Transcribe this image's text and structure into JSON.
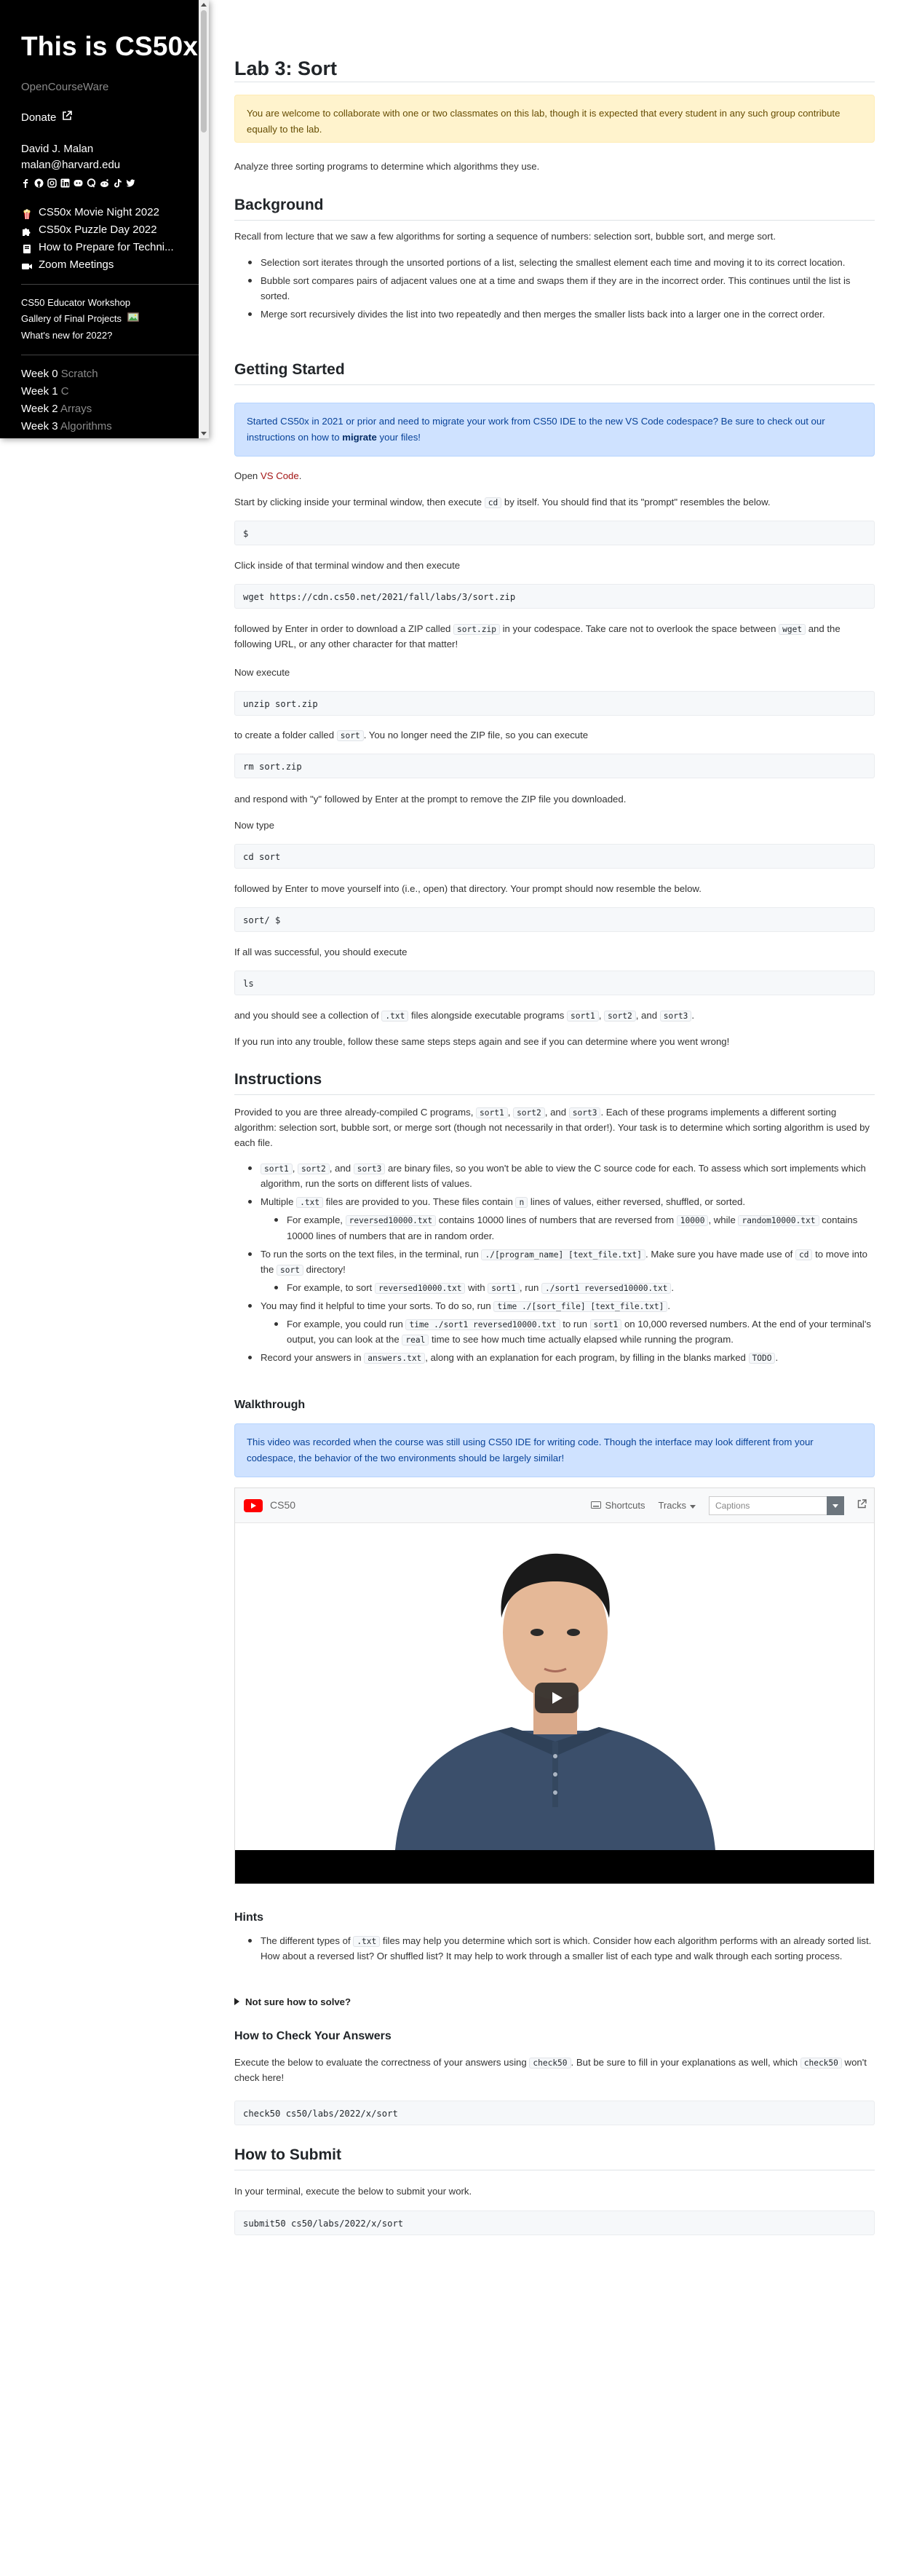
{
  "sidebar": {
    "title": "This is CS50x",
    "subtitle": "OpenCourseWare",
    "donate": "Donate",
    "author_name": "David J. Malan",
    "author_email": "malan@harvard.edu",
    "events": [
      {
        "icon": "popcorn-icon",
        "label": "CS50x Movie Night 2022"
      },
      {
        "icon": "puzzle-icon",
        "label": "CS50x Puzzle Day 2022"
      },
      {
        "icon": "book-icon",
        "label": "How to Prepare for Techni..."
      },
      {
        "icon": "video-camera-icon",
        "label": "Zoom Meetings"
      }
    ],
    "extras": [
      "CS50 Educator Workshop",
      "Gallery of Final Projects",
      "What's new for 2022?"
    ],
    "weeks": [
      {
        "num": "Week 0",
        "topic": "Scratch"
      },
      {
        "num": "Week 1",
        "topic": "C"
      },
      {
        "num": "Week 2",
        "topic": "Arrays"
      },
      {
        "num": "Week 3",
        "topic": "Algorithms"
      }
    ]
  },
  "page": {
    "title": "Lab 3: Sort",
    "collab_notice": "You are welcome to collaborate with one or two classmates on this lab, though it is expected that every student in any such group contribute equally to the lab.",
    "intro": "Analyze three sorting programs to determine which algorithms they use.",
    "background": {
      "heading": "Background",
      "text": "Recall from lecture that we saw a few algorithms for sorting a sequence of numbers: selection sort, bubble sort, and merge sort.",
      "bullets": [
        "Selection sort iterates through the unsorted portions of a list, selecting the smallest element each time and moving it to its correct location.",
        "Bubble sort compares pairs of adjacent values one at a time and swaps them if they are in the incorrect order. This continues until the list is sorted.",
        "Merge sort recursively divides the list into two repeatedly and then merges the smaller lists back into a larger one in the correct order."
      ]
    },
    "getting_started": {
      "heading": "Getting Started",
      "migrate_notice_pre": "Started CS50x in 2021 or prior and need to migrate your work from CS50 IDE to the new VS Code codespace? Be sure to check out our instructions on how to ",
      "migrate_notice_link": "migrate",
      "migrate_notice_post": " your files!",
      "open_pre": "Open ",
      "open_link": "VS Code",
      "open_post": ".",
      "start_text_pre": "Start by clicking inside your terminal window, then execute ",
      "start_code": "cd",
      "start_text_post": " by itself. You should find that its \"prompt\" resembles the below.",
      "prompt1": "$",
      "click_inside": "Click inside of that terminal window and then execute",
      "wget_cmd": "wget https://cdn.cs50.net/2021/fall/labs/3/sort.zip",
      "followed_pre": "followed by Enter in order to download a ZIP called ",
      "followed_code1": "sort.zip",
      "followed_mid": " in your codespace. Take care not to overlook the space between ",
      "followed_code2": "wget",
      "followed_post": " and the following URL, or any other character for that matter!",
      "now_execute": "Now execute",
      "unzip_cmd": "unzip sort.zip",
      "create_pre": "to create a folder called ",
      "create_code": "sort",
      "create_post": ". You no longer need the ZIP file, so you can execute",
      "rm_cmd": "rm sort.zip",
      "respond": "and respond with \"y\" followed by Enter at the prompt to remove the ZIP file you downloaded.",
      "now_type": "Now type",
      "cd_cmd": "cd sort",
      "followed_enter": "followed by Enter to move yourself into (i.e., open) that directory. Your prompt should now resemble the below.",
      "prompt2": "sort/ $",
      "if_success": "If all was successful, you should execute",
      "ls_cmd": "ls",
      "see_pre": "and you should see a collection of ",
      "see_code1": ".txt",
      "see_mid": " files alongside executable programs ",
      "see_code2": "sort1",
      "see_code3": "sort2",
      "see_code4": "sort3",
      "see_and": ", and ",
      "see_comma": ", ",
      "see_post": ".",
      "trouble": "If you run into any trouble, follow these same steps steps again and see if you can determine where you went wrong!"
    },
    "instructions": {
      "heading": "Instructions",
      "p1_pre": "Provided to you are three already-compiled C programs, ",
      "p1_c1": "sort1",
      "p1_c2": "sort2",
      "p1_c3": "sort3",
      "p1_post": ". Each of these programs implements a different sorting algorithm: selection sort, bubble sort, or merge sort (though not necessarily in that order!). Your task is to determine which sorting algorithm is used by each file.",
      "b1_post": " are binary files, so you won't be able to view the C source code for each. To assess which sort implements which algorithm, run the sorts on different lists of values.",
      "b2_pre": "Multiple ",
      "b2_code": ".txt",
      "b2_mid": " files are provided to you. These files contain ",
      "b2_code2": "n",
      "b2_post": " lines of values, either reversed, shuffled, or sorted.",
      "b2s_pre": "For example, ",
      "b2s_code1": "reversed10000.txt",
      "b2s_mid": " contains 10000 lines of numbers that are reversed from ",
      "b2s_code2": "10000",
      "b2s_mid2": ", while ",
      "b2s_code3": "random10000.txt",
      "b2s_post": " contains 10000 lines of numbers that are in random order.",
      "b3_pre": "To run the sorts on the text files, in the terminal, run ",
      "b3_code": "./[program_name] [text_file.txt]",
      "b3_mid": ". Make sure you have made use of ",
      "b3_code2": "cd",
      "b3_mid2": " to move into the ",
      "b3_code3": "sort",
      "b3_post": " directory!",
      "b3s_pre": "For example, to sort ",
      "b3s_code1": "reversed10000.txt",
      "b3s_mid": " with ",
      "b3s_code2": "sort1",
      "b3s_mid2": ", run ",
      "b3s_code3": "./sort1 reversed10000.txt",
      "b3s_post": ".",
      "b4_pre": "You may find it helpful to time your sorts. To do so, run ",
      "b4_code": "time ./[sort_file] [text_file.txt]",
      "b4_post": ".",
      "b4s_pre": "For example, you could run ",
      "b4s_code1": "time ./sort1 reversed10000.txt",
      "b4s_mid": " to run ",
      "b4s_code2": "sort1",
      "b4s_mid2": " on 10,000 reversed numbers. At the end of your terminal's output, you can look at the ",
      "b4s_code3": "real",
      "b4s_post": " time to see how much time actually elapsed while running the program.",
      "b5_pre": "Record your answers in ",
      "b5_code": "answers.txt",
      "b5_mid": ", along with an explanation for each program, by filling in the blanks marked ",
      "b5_code2": "TODO",
      "b5_post": "."
    },
    "walkthrough": {
      "heading": "Walkthrough",
      "notice": "This video was recorded when the course was still using CS50 IDE for writing code. Though the interface may look different from your codespace, the behavior of the two environments should be largely similar!",
      "video_channel": "CS50",
      "shortcuts": "Shortcuts",
      "tracks": "Tracks",
      "captions_placeholder": "Captions"
    },
    "hints": {
      "heading": "Hints",
      "b1_pre": "The different types of ",
      "b1_code": ".txt",
      "b1_post": " files may help you determine which sort is which. Consider how each algorithm performs with an already sorted list. How about a reversed list? Or shuffled list? It may help to work through a smaller list of each type and walk through each sorting process.",
      "summary": "Not sure how to solve?"
    },
    "check": {
      "heading": "How to Check Your Answers",
      "text_pre": "Execute the below to evaluate the correctness of your answers using ",
      "text_code": "check50",
      "text_mid": ". But be sure to fill in your explanations as well, which ",
      "text_code2": "check50",
      "text_post": " won't check here!",
      "cmd": "check50 cs50/labs/2022/x/sort"
    },
    "submit": {
      "heading": "How to Submit",
      "text": "In your terminal, execute the below to submit your work.",
      "cmd": "submit50 cs50/labs/2022/x/sort"
    }
  },
  "colors": {
    "link": "#a31515",
    "warning_bg": "#fff3cd",
    "info_bg": "#cfe2ff",
    "youtube_red": "#ff0000"
  }
}
